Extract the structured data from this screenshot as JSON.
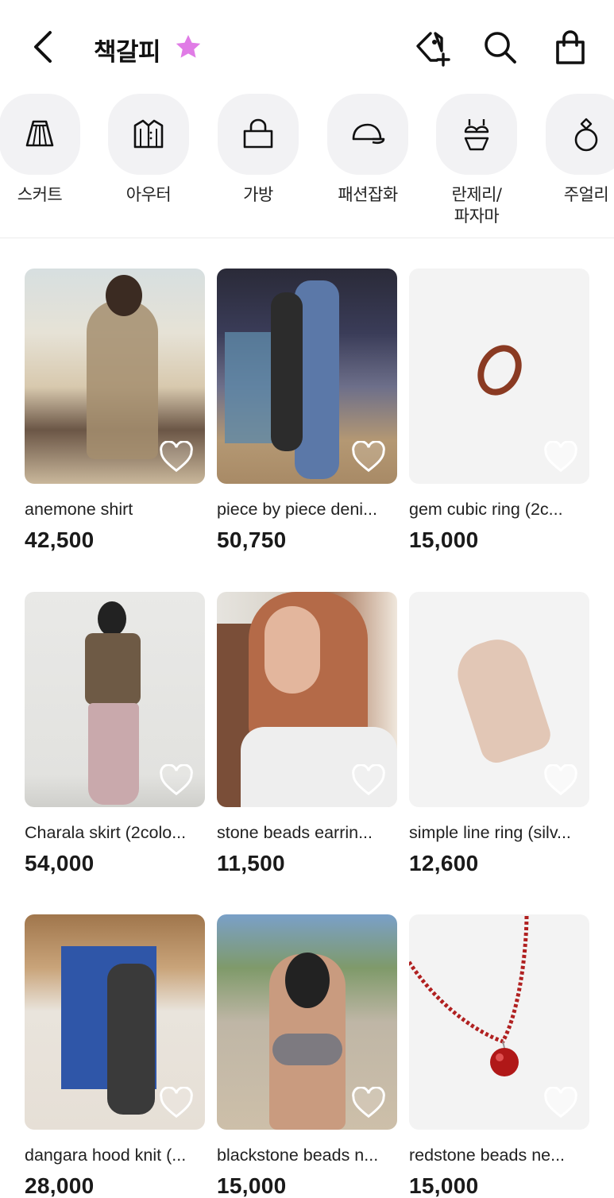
{
  "header": {
    "title": "책갈피",
    "back_icon": "chevron-left-icon",
    "favorite_icon": "star-icon",
    "star_color": "#e07ce6",
    "actions": [
      "coupon-tag-icon",
      "search-icon",
      "shopping-bag-icon"
    ]
  },
  "categories": [
    {
      "label": "스커트",
      "icon": "skirt-icon"
    },
    {
      "label": "아우터",
      "icon": "jacket-icon"
    },
    {
      "label": "가방",
      "icon": "bag-icon"
    },
    {
      "label": "패션잡화",
      "icon": "cap-icon"
    },
    {
      "label": "란제리/\n파자마",
      "icon": "lingerie-icon"
    },
    {
      "label": "주얼리",
      "icon": "ring-icon"
    }
  ],
  "products": [
    {
      "name": "anemone shirt",
      "price": "42,500",
      "favorited": false
    },
    {
      "name": "piece by piece deni...",
      "price": "50,750",
      "favorited": false
    },
    {
      "name": "gem cubic ring (2c...",
      "price": "15,000",
      "favorited": false
    },
    {
      "name": "Charala skirt (2colo...",
      "price": "54,000",
      "favorited": false
    },
    {
      "name": "stone beads earrin...",
      "price": "11,500",
      "favorited": false
    },
    {
      "name": "simple line ring (silv...",
      "price": "12,600",
      "favorited": false
    },
    {
      "name": "dangara hood knit (...",
      "price": "28,000",
      "favorited": false
    },
    {
      "name": "blackstone beads n...",
      "price": "15,000",
      "favorited": false
    },
    {
      "name": "redstone beads ne...",
      "price": "15,000",
      "favorited": false
    }
  ]
}
